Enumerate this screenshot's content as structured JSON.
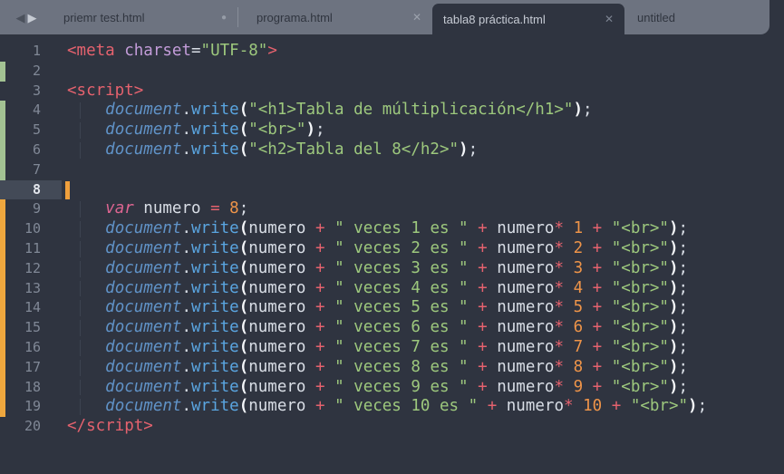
{
  "colors": {
    "editor_bg": "#2f3440",
    "tabbar_bg": "#6d7380",
    "active_tab_bg": "#2f3440",
    "tab_text_inactive": "#30353f",
    "tab_text_active": "#c6cbd4",
    "separator": "#878e99",
    "dot": "#969ca7",
    "close_inactive": "#9ba1ac",
    "close_active": "#7b8290",
    "arrow_back": "#4b515c",
    "arrow_fwd": "#c6cbd3",
    "gutter_text": "#808896",
    "current_line_bg": "#434a57",
    "current_line_text": "#e2e6ec",
    "git_added": "#a3c293",
    "git_modified": "#efa73e",
    "caret": "#f0a03c",
    "indent_guide": "#3c4350",
    "tag": "#e5626e",
    "attr": "#c39cd9",
    "string": "#9dc87d",
    "keyword": "#dd6591",
    "object": "#6093c8",
    "function": "#5aa5e0",
    "operator": "#e5626e",
    "number": "#ee9449",
    "plain": "#d9dee6",
    "bracket": "#f4f6f9"
  },
  "icons": {
    "back": "◀",
    "forward": "▶",
    "close": "✕",
    "modified": "●"
  },
  "tabbar": {
    "tabs": [
      {
        "label": "priemr test.html",
        "indicator": "modified",
        "active": false,
        "separator_after": true
      },
      {
        "label": "programa.html",
        "indicator": "close",
        "active": false
      },
      {
        "label": "tabla8 práctica.html",
        "indicator": "close",
        "active": true
      },
      {
        "label": "untitled",
        "indicator": "none",
        "active": false
      }
    ]
  },
  "code": {
    "lines": [
      {
        "num": "1",
        "tokens": [
          [
            "t",
            "<meta"
          ],
          [
            "w",
            " "
          ],
          [
            "a",
            "charset"
          ],
          [
            "w",
            "="
          ],
          [
            "s",
            "\"UTF-8\""
          ],
          [
            "t",
            ">"
          ]
        ]
      },
      {
        "num": "2",
        "mark": "a",
        "tokens": []
      },
      {
        "num": "3",
        "tokens": [
          [
            "t",
            "<script>"
          ]
        ]
      },
      {
        "num": "4",
        "mark": "a",
        "tokens": [
          [
            "w",
            "    "
          ],
          [
            "d",
            "document"
          ],
          [
            "w",
            "."
          ],
          [
            "f",
            "write"
          ],
          [
            "b",
            "("
          ],
          [
            "s",
            "\"<h1>Tabla de múltiplicación</h1>\""
          ],
          [
            "b",
            ")"
          ],
          [
            "w",
            ";"
          ]
        ]
      },
      {
        "num": "5",
        "mark": "a",
        "tokens": [
          [
            "w",
            "    "
          ],
          [
            "d",
            "document"
          ],
          [
            "w",
            "."
          ],
          [
            "f",
            "write"
          ],
          [
            "b",
            "("
          ],
          [
            "s",
            "\"<br>\""
          ],
          [
            "b",
            ")"
          ],
          [
            "w",
            ";"
          ]
        ]
      },
      {
        "num": "6",
        "mark": "a",
        "tokens": [
          [
            "w",
            "    "
          ],
          [
            "d",
            "document"
          ],
          [
            "w",
            "."
          ],
          [
            "f",
            "write"
          ],
          [
            "b",
            "("
          ],
          [
            "s",
            "\"<h2>Tabla del 8</h2>\""
          ],
          [
            "b",
            ")"
          ],
          [
            "w",
            ";"
          ]
        ]
      },
      {
        "num": "7",
        "mark": "a",
        "tokens": []
      },
      {
        "num": "8",
        "current": true,
        "tokens": []
      },
      {
        "num": "9",
        "mark": "m",
        "tokens": [
          [
            "w",
            "    "
          ],
          [
            "k",
            "var"
          ],
          [
            "w",
            " numero "
          ],
          [
            "o",
            "="
          ],
          [
            "w",
            " "
          ],
          [
            "n",
            "8"
          ],
          [
            "w",
            ";"
          ]
        ]
      },
      {
        "num": "10",
        "mark": "m",
        "tokens": [
          [
            "w",
            "    "
          ],
          [
            "d",
            "document"
          ],
          [
            "w",
            "."
          ],
          [
            "f",
            "write"
          ],
          [
            "b",
            "("
          ],
          [
            "w",
            "numero "
          ],
          [
            "o",
            "+"
          ],
          [
            "w",
            " "
          ],
          [
            "s",
            "\" veces 1 es \""
          ],
          [
            "w",
            " "
          ],
          [
            "o",
            "+"
          ],
          [
            "w",
            " numero"
          ],
          [
            "o",
            "*"
          ],
          [
            "w",
            " "
          ],
          [
            "n",
            "1"
          ],
          [
            "w",
            " "
          ],
          [
            "o",
            "+"
          ],
          [
            "w",
            " "
          ],
          [
            "s",
            "\"<br>\""
          ],
          [
            "b",
            ")"
          ],
          [
            "w",
            ";"
          ]
        ]
      },
      {
        "num": "11",
        "mark": "m",
        "tokens": [
          [
            "w",
            "    "
          ],
          [
            "d",
            "document"
          ],
          [
            "w",
            "."
          ],
          [
            "f",
            "write"
          ],
          [
            "b",
            "("
          ],
          [
            "w",
            "numero "
          ],
          [
            "o",
            "+"
          ],
          [
            "w",
            " "
          ],
          [
            "s",
            "\" veces 2 es \""
          ],
          [
            "w",
            " "
          ],
          [
            "o",
            "+"
          ],
          [
            "w",
            " numero"
          ],
          [
            "o",
            "*"
          ],
          [
            "w",
            " "
          ],
          [
            "n",
            "2"
          ],
          [
            "w",
            " "
          ],
          [
            "o",
            "+"
          ],
          [
            "w",
            " "
          ],
          [
            "s",
            "\"<br>\""
          ],
          [
            "b",
            ")"
          ],
          [
            "w",
            ";"
          ]
        ]
      },
      {
        "num": "12",
        "mark": "m",
        "tokens": [
          [
            "w",
            "    "
          ],
          [
            "d",
            "document"
          ],
          [
            "w",
            "."
          ],
          [
            "f",
            "write"
          ],
          [
            "b",
            "("
          ],
          [
            "w",
            "numero "
          ],
          [
            "o",
            "+"
          ],
          [
            "w",
            " "
          ],
          [
            "s",
            "\" veces 3 es \""
          ],
          [
            "w",
            " "
          ],
          [
            "o",
            "+"
          ],
          [
            "w",
            " numero"
          ],
          [
            "o",
            "*"
          ],
          [
            "w",
            " "
          ],
          [
            "n",
            "3"
          ],
          [
            "w",
            " "
          ],
          [
            "o",
            "+"
          ],
          [
            "w",
            " "
          ],
          [
            "s",
            "\"<br>\""
          ],
          [
            "b",
            ")"
          ],
          [
            "w",
            ";"
          ]
        ]
      },
      {
        "num": "13",
        "mark": "m",
        "tokens": [
          [
            "w",
            "    "
          ],
          [
            "d",
            "document"
          ],
          [
            "w",
            "."
          ],
          [
            "f",
            "write"
          ],
          [
            "b",
            "("
          ],
          [
            "w",
            "numero "
          ],
          [
            "o",
            "+"
          ],
          [
            "w",
            " "
          ],
          [
            "s",
            "\" veces 4 es \""
          ],
          [
            "w",
            " "
          ],
          [
            "o",
            "+"
          ],
          [
            "w",
            " numero"
          ],
          [
            "o",
            "*"
          ],
          [
            "w",
            " "
          ],
          [
            "n",
            "4"
          ],
          [
            "w",
            " "
          ],
          [
            "o",
            "+"
          ],
          [
            "w",
            " "
          ],
          [
            "s",
            "\"<br>\""
          ],
          [
            "b",
            ")"
          ],
          [
            "w",
            ";"
          ]
        ]
      },
      {
        "num": "14",
        "mark": "m",
        "tokens": [
          [
            "w",
            "    "
          ],
          [
            "d",
            "document"
          ],
          [
            "w",
            "."
          ],
          [
            "f",
            "write"
          ],
          [
            "b",
            "("
          ],
          [
            "w",
            "numero "
          ],
          [
            "o",
            "+"
          ],
          [
            "w",
            " "
          ],
          [
            "s",
            "\" veces 5 es \""
          ],
          [
            "w",
            " "
          ],
          [
            "o",
            "+"
          ],
          [
            "w",
            " numero"
          ],
          [
            "o",
            "*"
          ],
          [
            "w",
            " "
          ],
          [
            "n",
            "5"
          ],
          [
            "w",
            " "
          ],
          [
            "o",
            "+"
          ],
          [
            "w",
            " "
          ],
          [
            "s",
            "\"<br>\""
          ],
          [
            "b",
            ")"
          ],
          [
            "w",
            ";"
          ]
        ]
      },
      {
        "num": "15",
        "mark": "m",
        "tokens": [
          [
            "w",
            "    "
          ],
          [
            "d",
            "document"
          ],
          [
            "w",
            "."
          ],
          [
            "f",
            "write"
          ],
          [
            "b",
            "("
          ],
          [
            "w",
            "numero "
          ],
          [
            "o",
            "+"
          ],
          [
            "w",
            " "
          ],
          [
            "s",
            "\" veces 6 es \""
          ],
          [
            "w",
            " "
          ],
          [
            "o",
            "+"
          ],
          [
            "w",
            " numero"
          ],
          [
            "o",
            "*"
          ],
          [
            "w",
            " "
          ],
          [
            "n",
            "6"
          ],
          [
            "w",
            " "
          ],
          [
            "o",
            "+"
          ],
          [
            "w",
            " "
          ],
          [
            "s",
            "\"<br>\""
          ],
          [
            "b",
            ")"
          ],
          [
            "w",
            ";"
          ]
        ]
      },
      {
        "num": "16",
        "mark": "m",
        "tokens": [
          [
            "w",
            "    "
          ],
          [
            "d",
            "document"
          ],
          [
            "w",
            "."
          ],
          [
            "f",
            "write"
          ],
          [
            "b",
            "("
          ],
          [
            "w",
            "numero "
          ],
          [
            "o",
            "+"
          ],
          [
            "w",
            " "
          ],
          [
            "s",
            "\" veces 7 es \""
          ],
          [
            "w",
            " "
          ],
          [
            "o",
            "+"
          ],
          [
            "w",
            " numero"
          ],
          [
            "o",
            "*"
          ],
          [
            "w",
            " "
          ],
          [
            "n",
            "7"
          ],
          [
            "w",
            " "
          ],
          [
            "o",
            "+"
          ],
          [
            "w",
            " "
          ],
          [
            "s",
            "\"<br>\""
          ],
          [
            "b",
            ")"
          ],
          [
            "w",
            ";"
          ]
        ]
      },
      {
        "num": "17",
        "mark": "m",
        "tokens": [
          [
            "w",
            "    "
          ],
          [
            "d",
            "document"
          ],
          [
            "w",
            "."
          ],
          [
            "f",
            "write"
          ],
          [
            "b",
            "("
          ],
          [
            "w",
            "numero "
          ],
          [
            "o",
            "+"
          ],
          [
            "w",
            " "
          ],
          [
            "s",
            "\" veces 8 es \""
          ],
          [
            "w",
            " "
          ],
          [
            "o",
            "+"
          ],
          [
            "w",
            " numero"
          ],
          [
            "o",
            "*"
          ],
          [
            "w",
            " "
          ],
          [
            "n",
            "8"
          ],
          [
            "w",
            " "
          ],
          [
            "o",
            "+"
          ],
          [
            "w",
            " "
          ],
          [
            "s",
            "\"<br>\""
          ],
          [
            "b",
            ")"
          ],
          [
            "w",
            ";"
          ]
        ]
      },
      {
        "num": "18",
        "mark": "m",
        "tokens": [
          [
            "w",
            "    "
          ],
          [
            "d",
            "document"
          ],
          [
            "w",
            "."
          ],
          [
            "f",
            "write"
          ],
          [
            "b",
            "("
          ],
          [
            "w",
            "numero "
          ],
          [
            "o",
            "+"
          ],
          [
            "w",
            " "
          ],
          [
            "s",
            "\" veces 9 es \""
          ],
          [
            "w",
            " "
          ],
          [
            "o",
            "+"
          ],
          [
            "w",
            " numero"
          ],
          [
            "o",
            "*"
          ],
          [
            "w",
            " "
          ],
          [
            "n",
            "9"
          ],
          [
            "w",
            " "
          ],
          [
            "o",
            "+"
          ],
          [
            "w",
            " "
          ],
          [
            "s",
            "\"<br>\""
          ],
          [
            "b",
            ")"
          ],
          [
            "w",
            ";"
          ]
        ]
      },
      {
        "num": "19",
        "mark": "m",
        "tokens": [
          [
            "w",
            "    "
          ],
          [
            "d",
            "document"
          ],
          [
            "w",
            "."
          ],
          [
            "f",
            "write"
          ],
          [
            "b",
            "("
          ],
          [
            "w",
            "numero "
          ],
          [
            "o",
            "+"
          ],
          [
            "w",
            " "
          ],
          [
            "s",
            "\" veces 10 es \""
          ],
          [
            "w",
            " "
          ],
          [
            "o",
            "+"
          ],
          [
            "w",
            " numero"
          ],
          [
            "o",
            "*"
          ],
          [
            "w",
            " "
          ],
          [
            "n",
            "10"
          ],
          [
            "w",
            " "
          ],
          [
            "o",
            "+"
          ],
          [
            "w",
            " "
          ],
          [
            "s",
            "\"<br>\""
          ],
          [
            "b",
            ")"
          ],
          [
            "w",
            ";"
          ]
        ]
      },
      {
        "num": "20",
        "tokens": [
          [
            "t",
            "</script>"
          ]
        ]
      }
    ]
  }
}
